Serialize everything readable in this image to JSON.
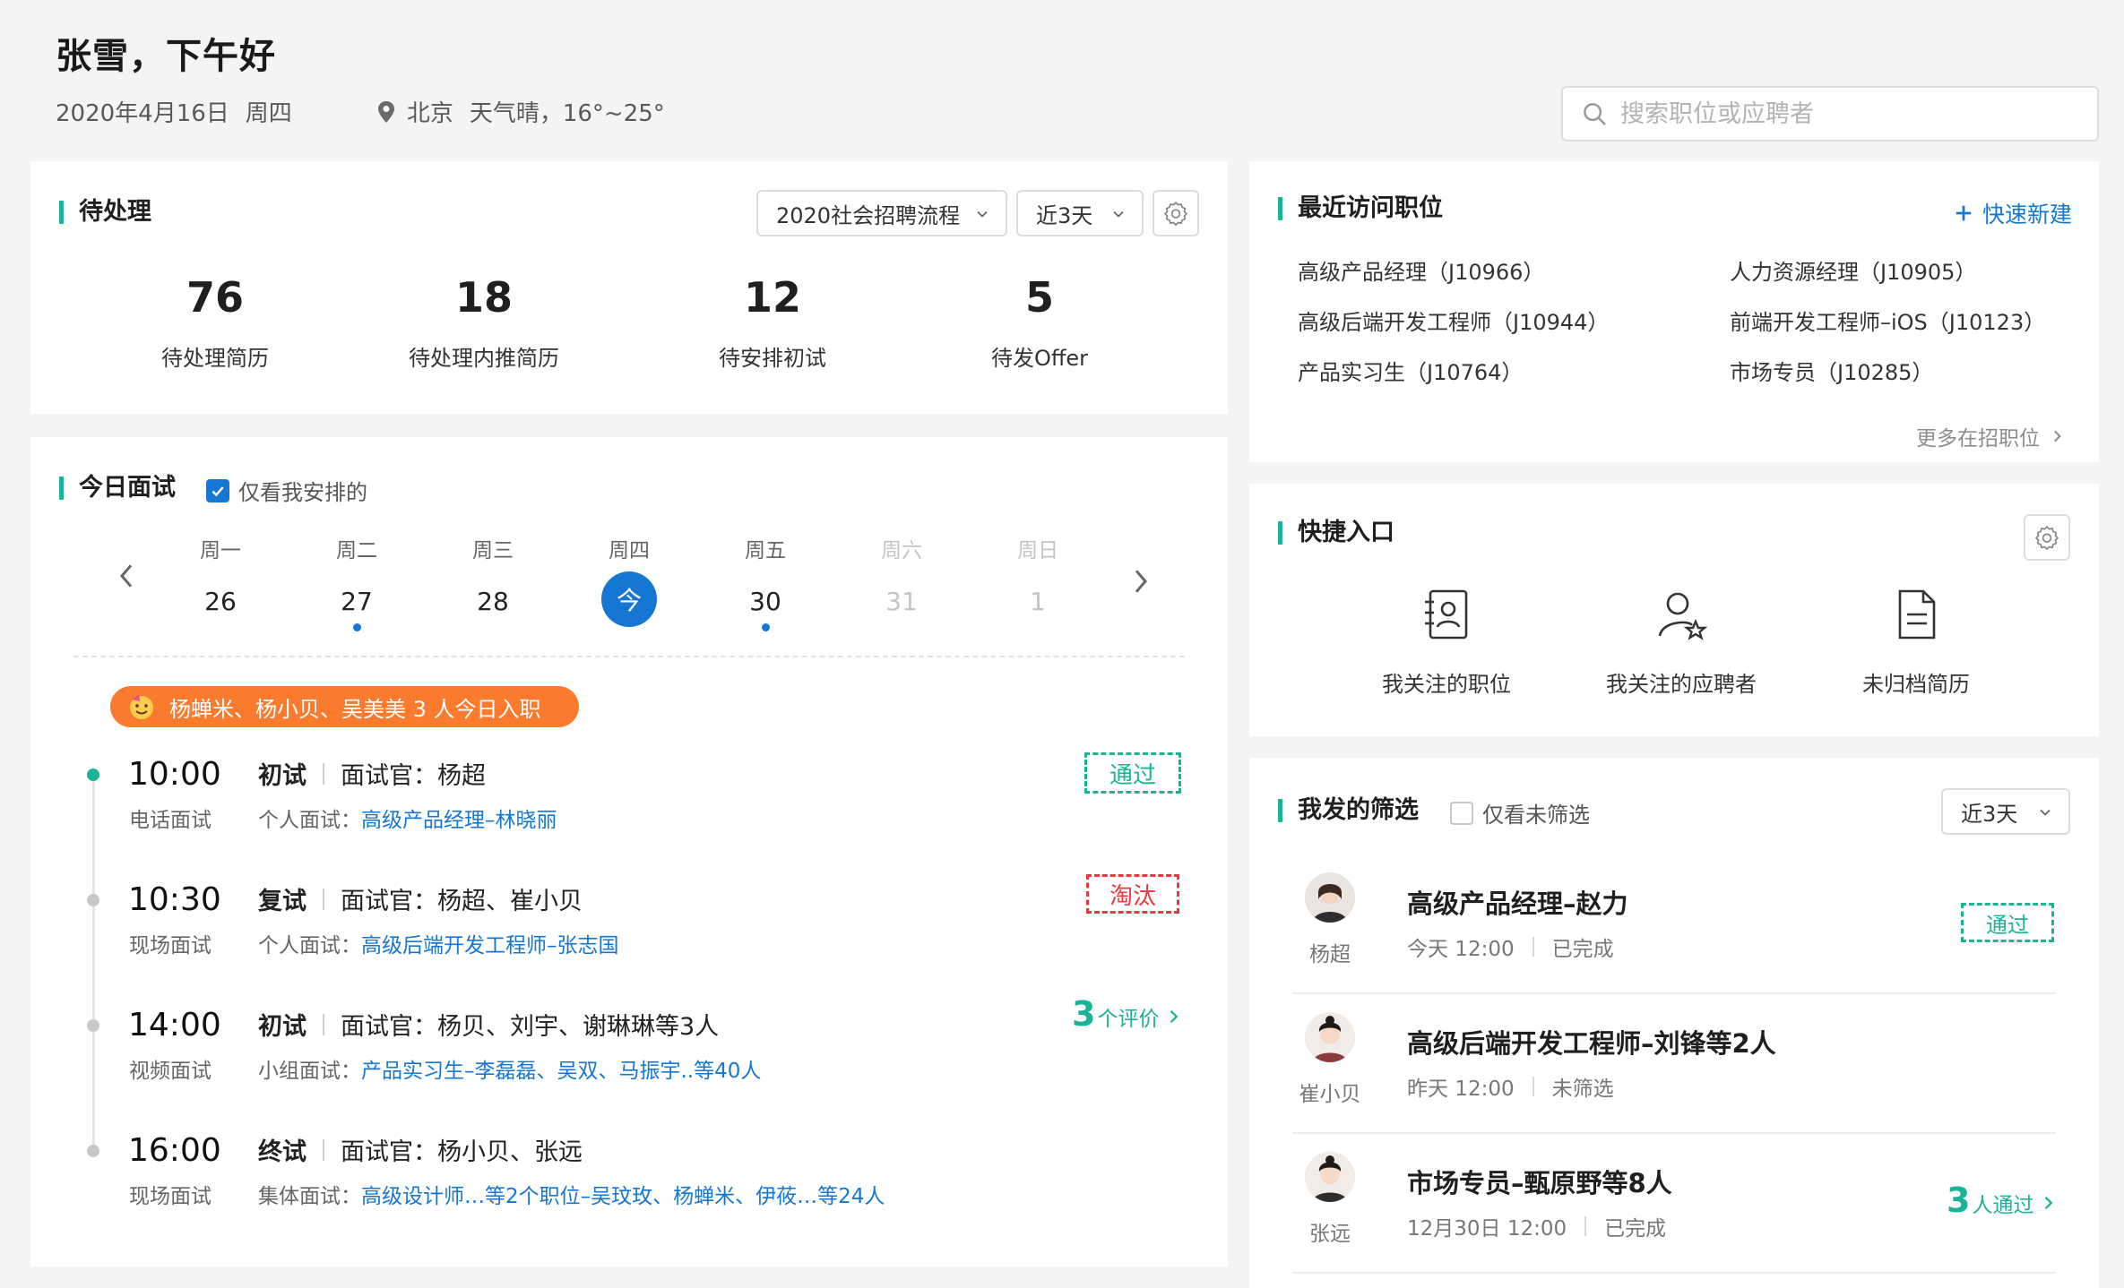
{
  "header": {
    "greeting": "张雪，下午好",
    "date": "2020年4月16日",
    "weekday": "周四",
    "city": "北京",
    "weather": "天气晴，16°~25°"
  },
  "search": {
    "placeholder": "搜索职位或应聘者"
  },
  "pending": {
    "title": "待处理",
    "process_select": "2020社会招聘流程",
    "range_select": "近3天",
    "stats": [
      {
        "value": "76",
        "label": "待处理简历"
      },
      {
        "value": "18",
        "label": "待处理内推简历"
      },
      {
        "value": "12",
        "label": "待安排初试"
      },
      {
        "value": "5",
        "label": "待发Offer"
      }
    ]
  },
  "interviews": {
    "title": "今日面试",
    "only_mine": "仅看我安排的",
    "days": [
      {
        "weekday": "周一",
        "day": "26"
      },
      {
        "weekday": "周二",
        "day": "27"
      },
      {
        "weekday": "周三",
        "day": "28"
      },
      {
        "weekday": "周四",
        "day": "今"
      },
      {
        "weekday": "周五",
        "day": "30"
      },
      {
        "weekday": "周六",
        "day": "31"
      },
      {
        "weekday": "周日",
        "day": "1"
      }
    ],
    "banner": "杨蝉米、杨小贝、吴美美 3 人今日入职",
    "items": [
      {
        "time": "10:00",
        "mode": "电话面试",
        "round": "初试",
        "interviewer": "面试官：杨超",
        "kind": "个人面试：",
        "link": "高级产品经理–林晓丽",
        "status": "通过"
      },
      {
        "time": "10:30",
        "mode": "现场面试",
        "round": "复试",
        "interviewer": "面试官：杨超、崔小贝",
        "kind": "个人面试：",
        "link": "高级后端开发工程师–张志国",
        "status": "淘汰"
      },
      {
        "time": "14:00",
        "mode": "视频面试",
        "round": "初试",
        "interviewer": "面试官：杨贝、刘宇、谢琳琳等3人",
        "kind": "小组面试：",
        "link": "产品实习生–李磊磊、吴双、马振宇..等40人",
        "eval_count": "3",
        "eval_label": "个评价"
      },
      {
        "time": "16:00",
        "mode": "现场面试",
        "round": "终试",
        "interviewer": "面试官：杨小贝、张远",
        "kind": "集体面试：",
        "link": "高级设计师…等2个职位–吴玟玫、杨蝉米、伊莜…等24人"
      }
    ]
  },
  "recent_jobs": {
    "title": "最近访问职位",
    "quick_new": "快速新建",
    "jobs": [
      "高级产品经理（J10966）",
      "人力资源经理（J10905）",
      "高级后端开发工程师（J10944）",
      "前端开发工程师–iOS（J10123）",
      "产品实习生（J10764）",
      "市场专员（J10285）"
    ],
    "more": "更多在招职位"
  },
  "quick_entry": {
    "title": "快捷入口",
    "items": [
      {
        "label": "我关注的职位",
        "icon": "followed-jobs-icon"
      },
      {
        "label": "我关注的应聘者",
        "icon": "followed-candidates-icon"
      },
      {
        "label": "未归档简历",
        "icon": "document-icon"
      }
    ]
  },
  "screening": {
    "title": "我发的筛选",
    "only_unscreened": "仅看未筛选",
    "range_select": "近3天",
    "items": [
      {
        "user": "杨超",
        "title": "高级产品经理–赵力",
        "when": "今天  12:00",
        "state": "已完成",
        "status": "通过"
      },
      {
        "user": "崔小贝",
        "title": "高级后端开发工程师–刘锋等2人",
        "when": "昨天  12:00",
        "state": "未筛选"
      },
      {
        "user": "张远",
        "title": "市场专员–甄原野等8人",
        "when": "12月30日  12:00",
        "state": "已完成",
        "pass_count": "3",
        "pass_label": "人通过"
      }
    ]
  },
  "colors": {
    "accent_green": "#1ab394",
    "link_blue": "#1677d2",
    "danger_red": "#e8383d",
    "banner_orange": "#fa7a2e"
  }
}
